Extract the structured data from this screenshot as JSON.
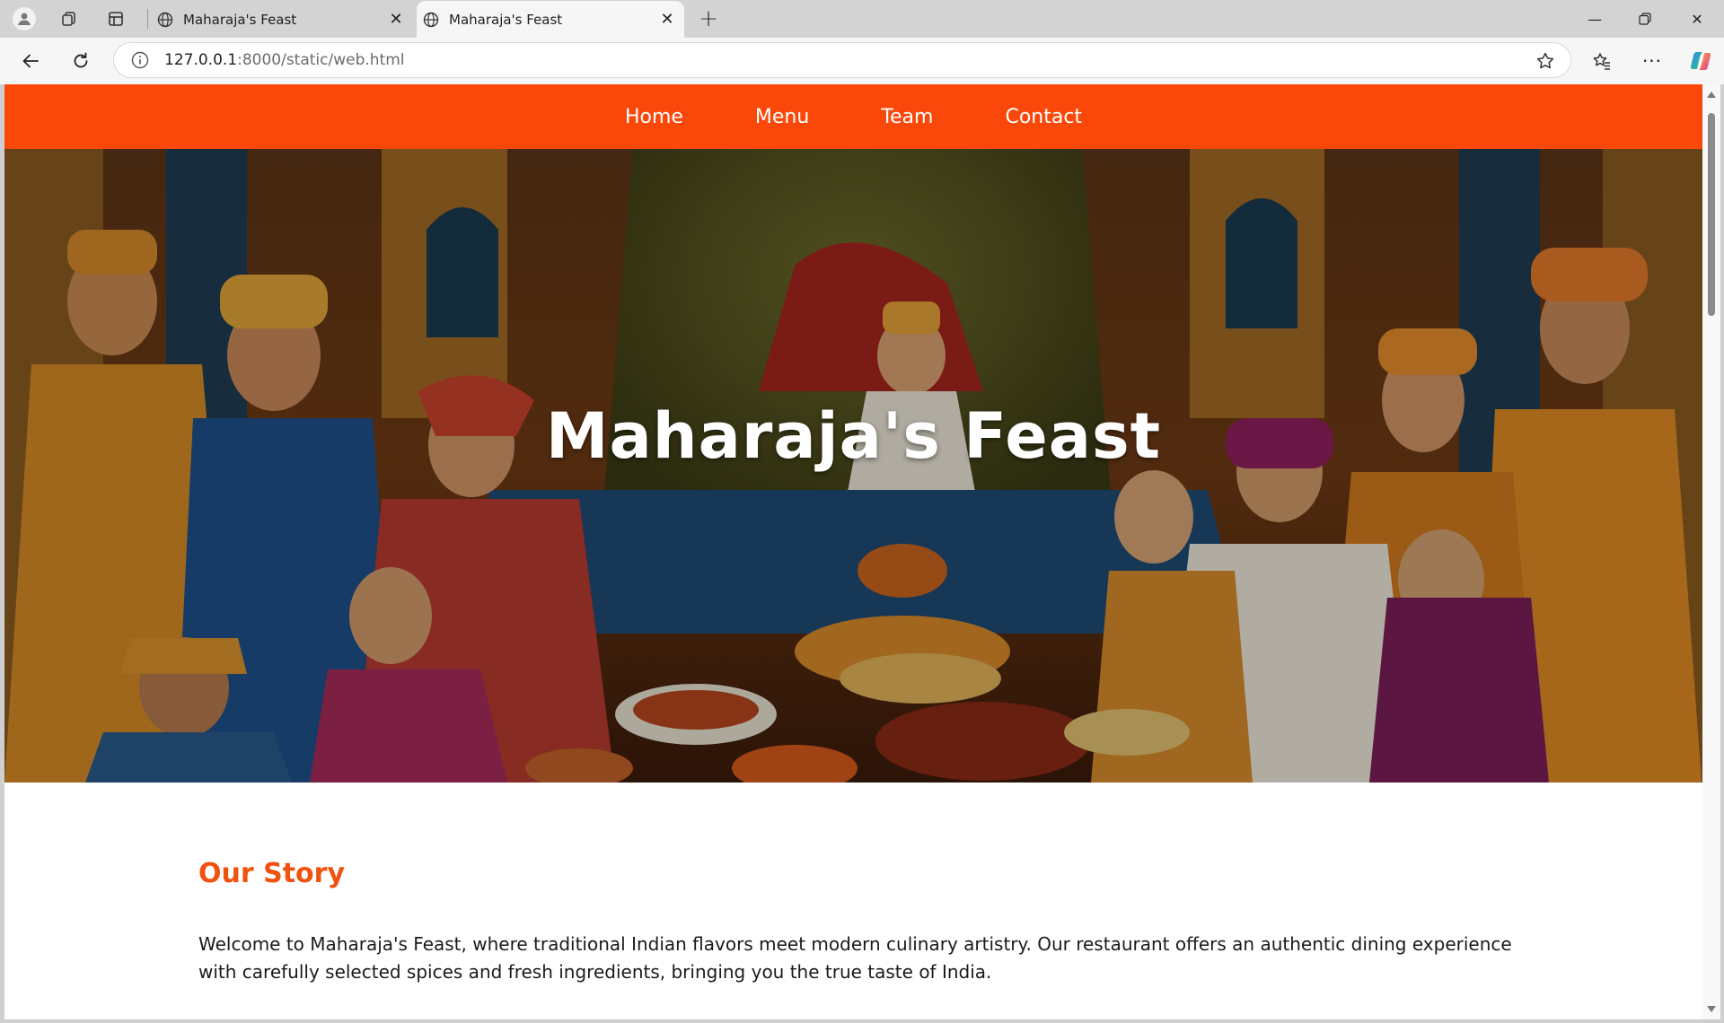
{
  "browser": {
    "tabs": [
      {
        "title": "Maharaja's Feast",
        "active": false
      },
      {
        "title": "Maharaja's Feast",
        "active": true
      }
    ],
    "address": {
      "host": "127.0.0.1",
      "rest": ":8000/static/web.html"
    },
    "icons": {
      "profile": "profile-icon",
      "workspaces": "workspaces-icon",
      "vertical_tabs": "vertical-tabs-icon",
      "new_tab": "plus-icon",
      "back": "back-arrow-icon",
      "reload": "reload-icon",
      "site_info": "info-icon",
      "favorite": "star-icon",
      "favorites": "favorites-icon",
      "more": "more-icon",
      "copilot": "copilot-icon"
    }
  },
  "site": {
    "nav": [
      {
        "label": "Home"
      },
      {
        "label": "Menu"
      },
      {
        "label": "Team"
      },
      {
        "label": "Contact"
      }
    ],
    "hero_title": "Maharaja's Feast",
    "story": {
      "heading": "Our Story",
      "text": "Welcome to Maharaja's Feast, where traditional Indian flavors meet modern culinary artistry. Our restaurant offers an authentic dining experience with carefully selected spices and fresh ingredients, bringing you the true taste of India."
    },
    "colors": {
      "accent": "#f9480a",
      "heading": "#f0520f"
    }
  }
}
